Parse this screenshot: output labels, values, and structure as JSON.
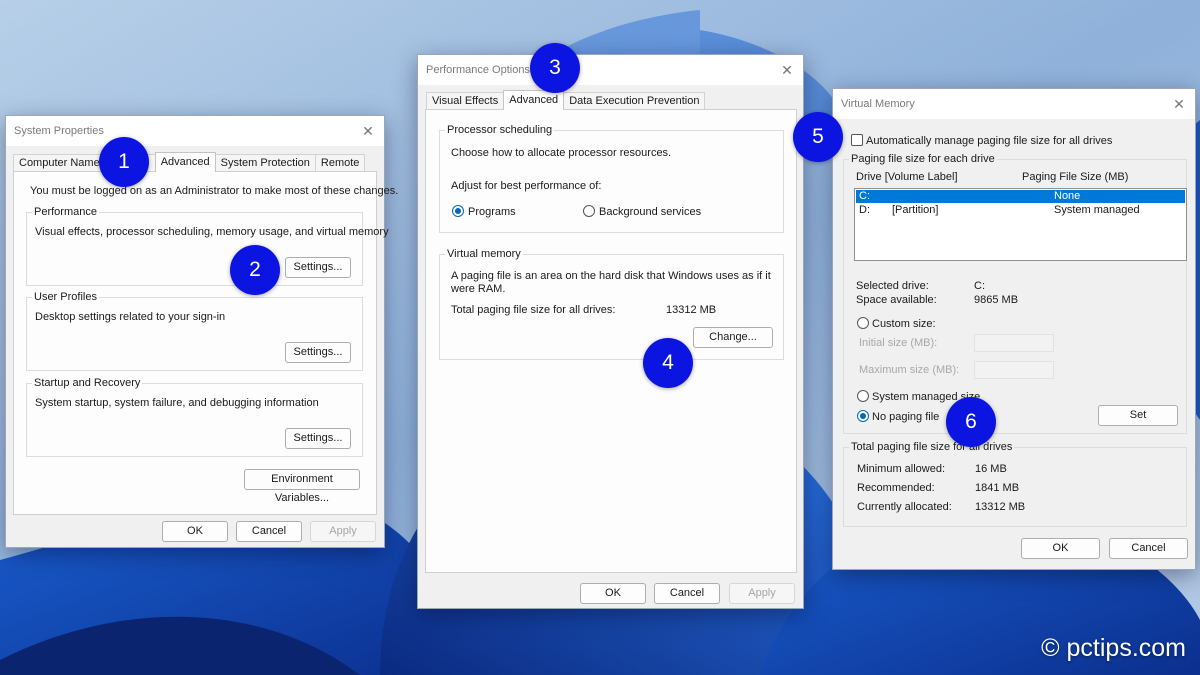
{
  "system_properties": {
    "title": "System Properties",
    "tabs": [
      "Computer Name",
      "Advanced",
      "System Protection",
      "Remote"
    ],
    "admin_note": "You must be logged on as an Administrator to make most of these changes.",
    "performance": {
      "heading": "Performance",
      "description": "Visual effects, processor scheduling, memory usage, and virtual memory",
      "settings_label": "Settings..."
    },
    "user_profiles": {
      "heading": "User Profiles",
      "description": "Desktop settings related to your sign-in",
      "settings_label": "Settings..."
    },
    "startup_recovery": {
      "heading": "Startup and Recovery",
      "description": "System startup, system failure, and debugging information",
      "settings_label": "Settings..."
    },
    "env_vars_label": "Environment Variables...",
    "ok_label": "OK",
    "cancel_label": "Cancel",
    "apply_label": "Apply"
  },
  "performance_options": {
    "title": "Performance Options",
    "tabs": [
      "Visual Effects",
      "Advanced",
      "Data Execution Prevention"
    ],
    "processor": {
      "heading": "Processor scheduling",
      "line1": "Choose how to allocate processor resources.",
      "line2": "Adjust for best performance of:",
      "opt_programs": "Programs",
      "opt_background": "Background services",
      "selected": "Programs"
    },
    "virtual_memory": {
      "heading": "Virtual memory",
      "description_line1": "A paging file is an area on the hard disk that Windows uses as if it",
      "description_line2": "were RAM.",
      "total_label": "Total paging file size for all drives:",
      "total_value": "13312 MB",
      "change_label": "Change..."
    },
    "ok_label": "OK",
    "cancel_label": "Cancel",
    "apply_label": "Apply"
  },
  "virtual_memory": {
    "title": "Virtual Memory",
    "auto_manage_label": "Automatically manage paging file size for all drives",
    "auto_manage_checked": false,
    "group_heading": "Paging file size for each drive",
    "col_drive": "Drive  [Volume Label]",
    "col_size": "Paging File Size (MB)",
    "drives": [
      {
        "drive": "C:",
        "label": "",
        "size": "None"
      },
      {
        "drive": "D:",
        "label": "[Partition]",
        "size": "System managed"
      }
    ],
    "selected_drive_label": "Selected drive:",
    "selected_drive_value": "C:",
    "space_available_label": "Space available:",
    "space_available_value": "9865 MB",
    "custom_size_label": "Custom size:",
    "initial_size_label": "Initial size (MB):",
    "maximum_size_label": "Maximum size (MB):",
    "system_managed_label": "System managed size",
    "no_paging_label": "No paging file",
    "selected_option": "No paging file",
    "set_label": "Set",
    "total_heading": "Total paging file size for all drives",
    "minimum_label": "Minimum allowed:",
    "minimum_value": "16 MB",
    "recommended_label": "Recommended:",
    "recommended_value": "1841 MB",
    "allocated_label": "Currently allocated:",
    "allocated_value": "13312 MB",
    "ok_label": "OK",
    "cancel_label": "Cancel"
  },
  "step_badges": [
    "1",
    "2",
    "3",
    "4",
    "5",
    "6"
  ],
  "watermark": {
    "symbol": "©",
    "text": "pctips.com"
  },
  "colors": {
    "badge": "#0b14e0",
    "accent": "#0067c0",
    "selection": "#0078d7"
  },
  "icons": {
    "close": "close-icon",
    "copyright": "copyright-icon"
  }
}
